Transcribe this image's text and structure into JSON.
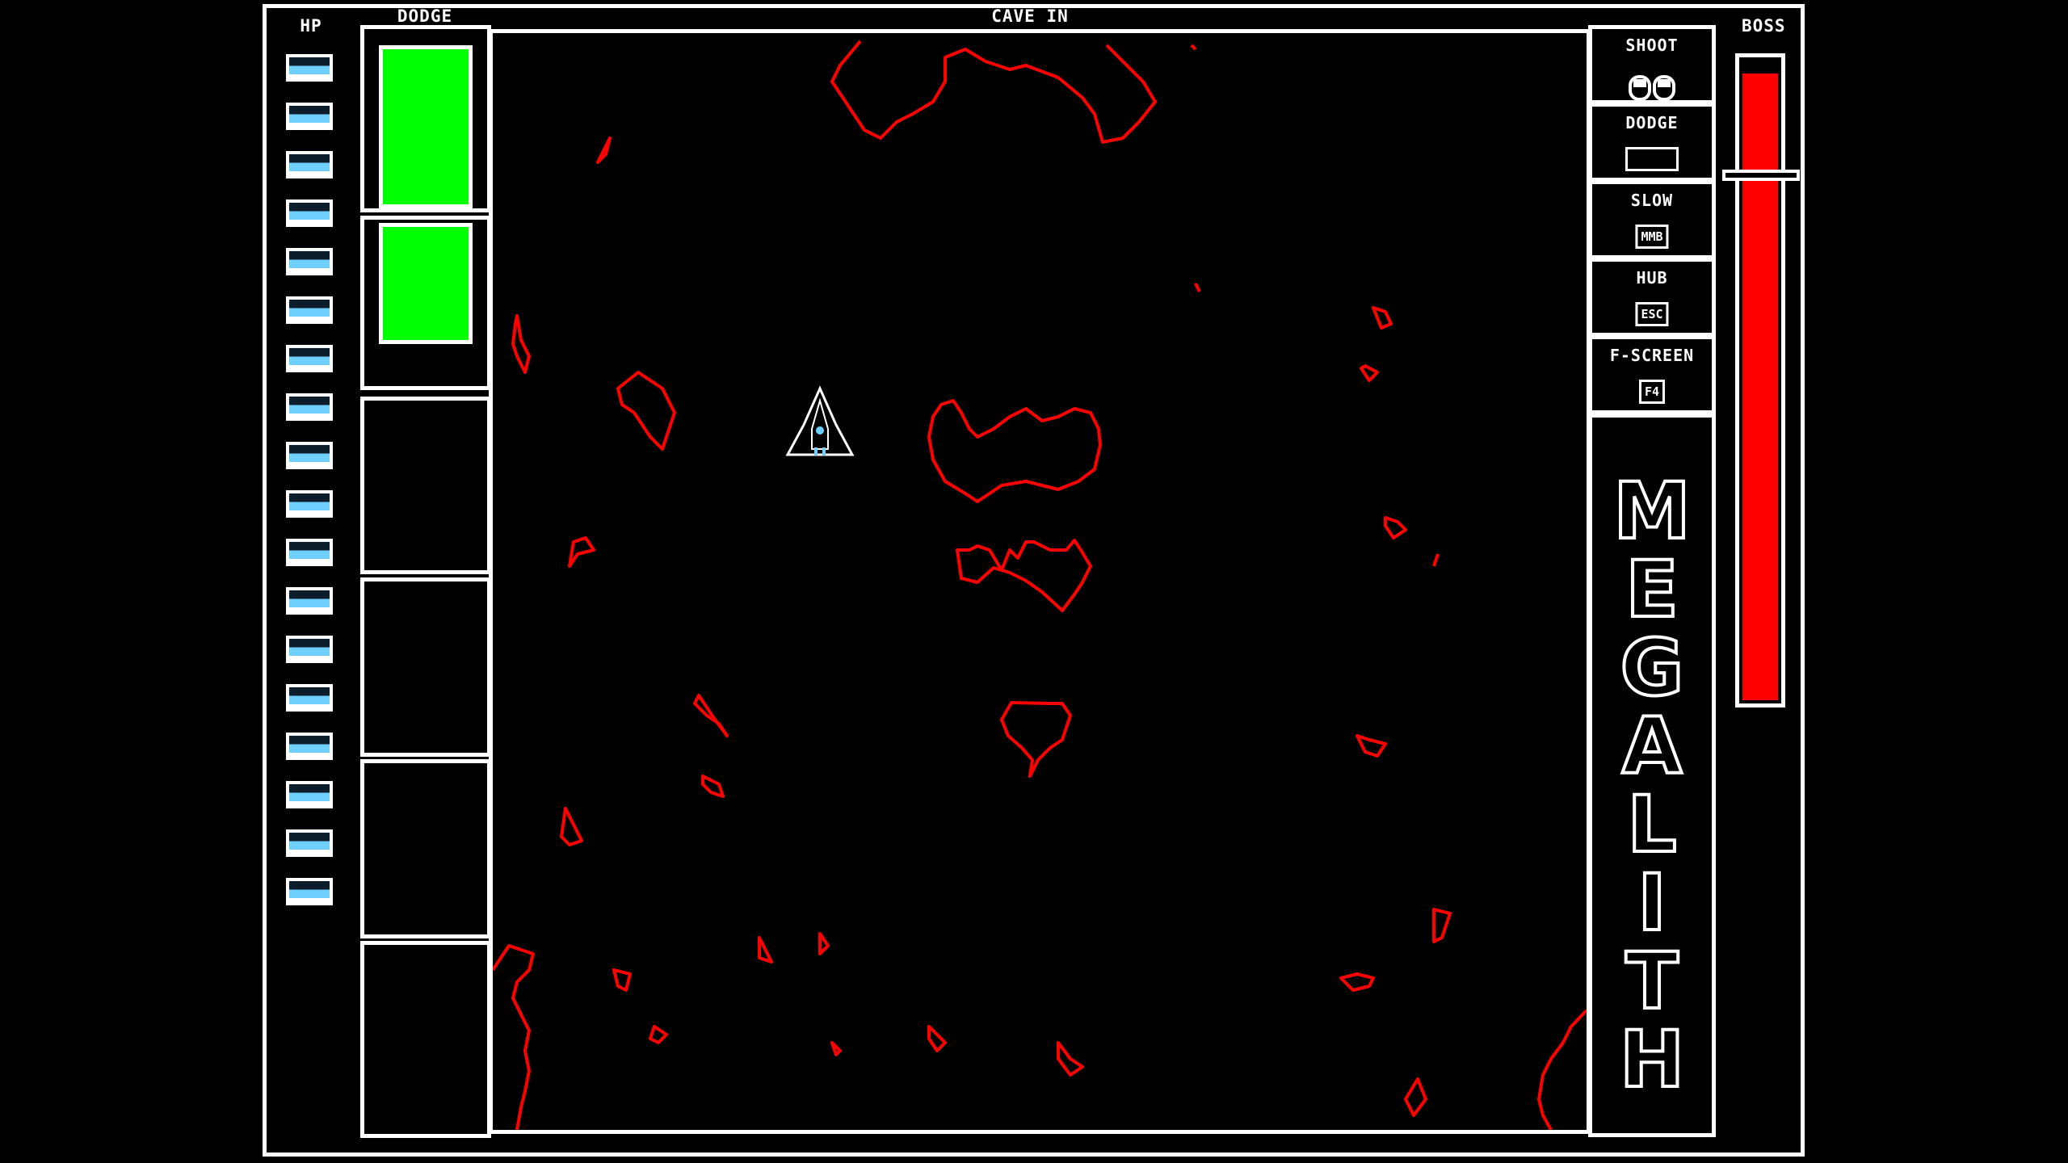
{
  "hud": {
    "hp_label": "HP",
    "dodge_label": "DODGE",
    "stage_title": "CAVE IN",
    "boss_label": "BOSS",
    "hp_pips": 18,
    "dodge_slots": 6,
    "dodge_filled": 2,
    "boss_health_fraction": 0.98
  },
  "controls": [
    {
      "label": "SHOOT",
      "key": "mouse-buttons-icon"
    },
    {
      "label": "DODGE",
      "key": "space-key-icon"
    },
    {
      "label": "SLOW",
      "key": "MMB"
    },
    {
      "label": "HUB",
      "key": "ESC"
    },
    {
      "label": "F-SCREEN",
      "key": "F4"
    }
  ],
  "logo": "MEGALITH",
  "colors": {
    "background": "#000000",
    "frame": "#ffffff",
    "cave_walls": "#ff0000",
    "dodge_fill": "#00ff00",
    "hp_pip": "#6fd0ff",
    "boss_bar": "#ff0000"
  }
}
